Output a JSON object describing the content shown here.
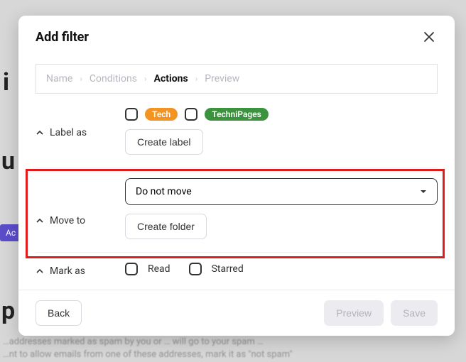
{
  "modal": {
    "title": "Add filter"
  },
  "breadcrumb": {
    "name": "Name",
    "conditions": "Conditions",
    "actions": "Actions",
    "preview": "Preview"
  },
  "labelAs": {
    "heading": "Label as",
    "labels": [
      {
        "name": "Tech",
        "color": "#f39322"
      },
      {
        "name": "TechniPages",
        "color": "#3b943d"
      }
    ],
    "createBtn": "Create label"
  },
  "moveTo": {
    "heading": "Move to",
    "selected": "Do not move",
    "createBtn": "Create folder"
  },
  "markAs": {
    "heading": "Mark as",
    "read": "Read",
    "starred": "Starred"
  },
  "footer": {
    "back": "Back",
    "preview": "Preview",
    "save": "Save"
  },
  "background": {
    "line1": "…addresses marked as spam by you or … will go to your spam …",
    "line2": "…nt to allow emails from one of these addresses, mark it as \"not spam\"",
    "badge": "Ac"
  }
}
